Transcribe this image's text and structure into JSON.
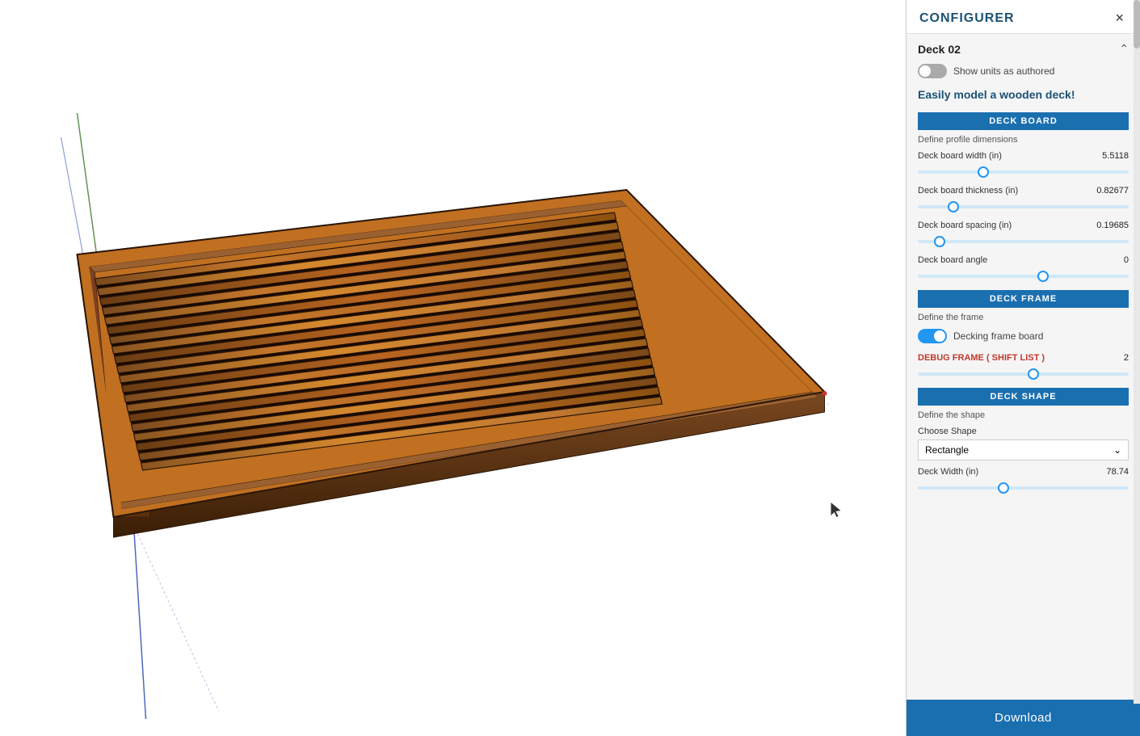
{
  "panel": {
    "title": "CONFIGURER",
    "close_label": "×",
    "deck_name": "Deck 02",
    "show_units_label": "Show units as authored",
    "show_units_on": false,
    "tagline": "Easily model a wooden deck!",
    "sections": {
      "deck_board": {
        "header": "DECK BOARD",
        "sublabel": "Define profile dimensions",
        "params": [
          {
            "label": "Deck board width (in)",
            "value": "5.5118",
            "fill_pct": 30
          },
          {
            "label": "Deck board thickness (in)",
            "value": "0.82677",
            "fill_pct": 15
          },
          {
            "label": "Deck board spacing (in)",
            "value": "0.19685",
            "fill_pct": 8
          },
          {
            "label": "Deck board angle",
            "value": "0",
            "fill_pct": 60
          }
        ]
      },
      "deck_frame": {
        "header": "DECK FRAME",
        "sublabel": "Define the frame",
        "toggle_label": "Decking frame board",
        "toggle_on": true,
        "debug_label": "DEBUG FRAME ( SHIFT LIST )",
        "debug_value": "2",
        "debug_fill_pct": 55
      },
      "deck_shape": {
        "header": "DECK SHAPE",
        "sublabel": "Define the shape",
        "choose_shape_label": "Choose Shape",
        "shape_selected": "Rectangle",
        "deck_width_label": "Deck Width (in)",
        "deck_width_value": "78.74",
        "deck_width_fill_pct": 40
      }
    },
    "download_label": "Download"
  },
  "viewport": {
    "bg_color": "#ffffff"
  }
}
